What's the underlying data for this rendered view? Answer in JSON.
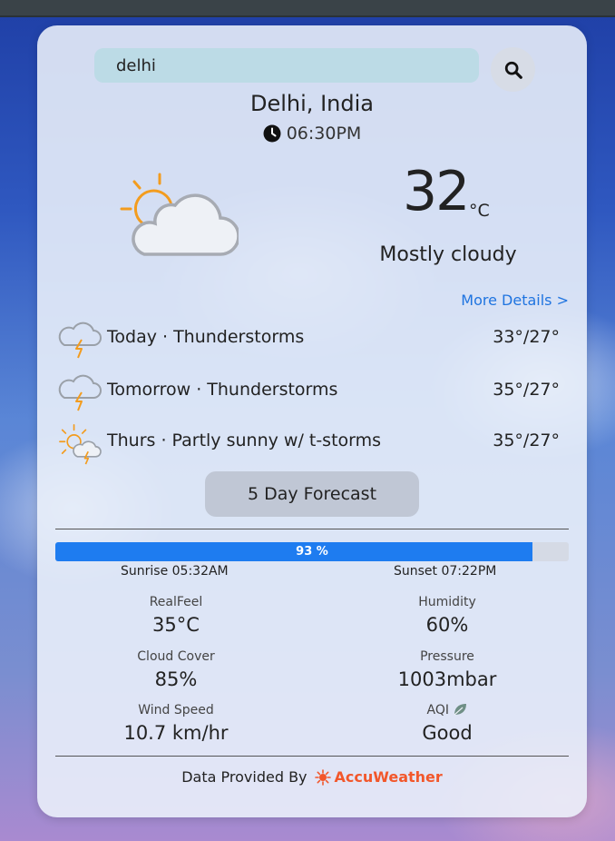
{
  "search": {
    "value": "delhi",
    "icon": "search-icon"
  },
  "location": {
    "name": "Delhi, India",
    "time": "06:30PM",
    "time_icon": "clock-icon"
  },
  "current": {
    "icon": "partly-cloudy-icon",
    "temperature": "32",
    "unit": "°C",
    "condition": "Mostly cloudy"
  },
  "more_details": "More Details >",
  "forecast": [
    {
      "label": "Today · Thunderstorms",
      "temps": "33°/27°",
      "icon": "thunderstorm-icon"
    },
    {
      "label": "Tomorrow · Thunderstorms",
      "temps": "35°/27°",
      "icon": "thunderstorm-icon"
    },
    {
      "label": "Thurs · Partly sunny w/ t-storms",
      "temps": "35°/27°",
      "icon": "partly-sunny-tstorm-icon"
    }
  ],
  "five_day_button": "5 Day Forecast",
  "daylight": {
    "progress": 93,
    "progress_label": "93 %",
    "sunrise": "Sunrise 05:32AM",
    "sunset": "Sunset 07:22PM"
  },
  "stats": {
    "realfeel": {
      "label": "RealFeel",
      "value": "35°C"
    },
    "humidity": {
      "label": "Humidity",
      "value": "60%"
    },
    "cloud_cover": {
      "label": "Cloud Cover",
      "value": "85%"
    },
    "pressure": {
      "label": "Pressure",
      "value": "1003mbar"
    },
    "wind_speed": {
      "label": "Wind Speed",
      "value": "10.7 km/hr"
    },
    "aqi": {
      "label": "AQI",
      "value": "Good",
      "icon": "leaf-icon"
    }
  },
  "footer": {
    "text": "Data Provided By",
    "brand": "AccuWeather",
    "brand_color": "#f2572b"
  },
  "colors": {
    "accent": "#1e7cf0",
    "link": "#1f74e0",
    "sun": "#f39c1e"
  }
}
